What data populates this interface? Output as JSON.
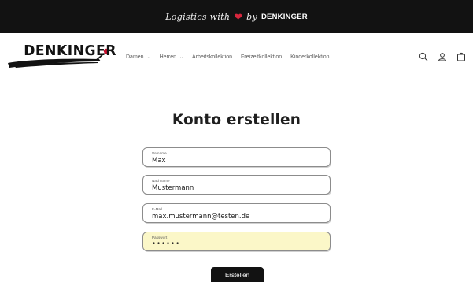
{
  "announcement": {
    "script_text": "Logistics with",
    "heart_icon": "heart-icon",
    "by_text": "by",
    "brand": "DENKINGER"
  },
  "header": {
    "logo_text": "DENKINGER",
    "nav": [
      {
        "label": "Damen",
        "has_dropdown": true
      },
      {
        "label": "Herren",
        "has_dropdown": true
      },
      {
        "label": "Arbeitskollektion",
        "has_dropdown": false
      },
      {
        "label": "Freizeitkollektion",
        "has_dropdown": false
      },
      {
        "label": "Kinderkollektion",
        "has_dropdown": false
      }
    ],
    "icons": [
      "search-icon",
      "account-icon",
      "cart-icon"
    ]
  },
  "form": {
    "title": "Konto erstellen",
    "fields": [
      {
        "label": "Vorname",
        "value": "Max"
      },
      {
        "label": "Nachname",
        "value": "Mustermann"
      },
      {
        "label": "E-Mail",
        "value": "max.mustermann@testen.de"
      },
      {
        "label": "Passwort",
        "value": "••••••"
      }
    ],
    "submit_label": "Erstellen"
  },
  "colors": {
    "bar_background": "#121212",
    "heart": "#d7263d",
    "logo_rose": "#c8102e",
    "autofill_background": "#fbf7c8",
    "button_background": "#121212"
  }
}
